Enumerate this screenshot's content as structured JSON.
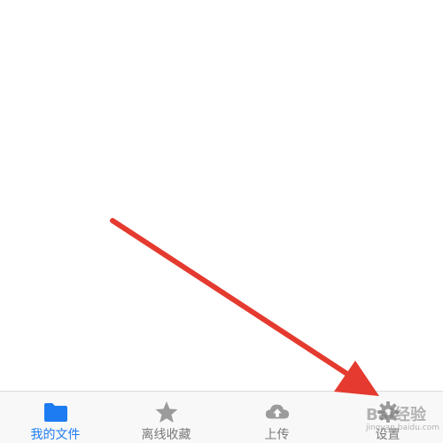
{
  "tabbar": {
    "tabs": [
      {
        "label": "我的文件",
        "icon": "folder-icon",
        "active": true
      },
      {
        "label": "离线收藏",
        "icon": "star-icon",
        "active": false
      },
      {
        "label": "上传",
        "icon": "cloud-upload-icon",
        "active": false
      },
      {
        "label": "设置",
        "icon": "gear-icon",
        "active": false
      }
    ]
  },
  "annotation": {
    "arrow_color": "#e53a2f"
  },
  "watermark": {
    "text": "Bai经验",
    "subtext": "jingyan.baidu.com"
  },
  "colors": {
    "active": "#1d7cf2",
    "inactive": "#7a7a7a",
    "icon_inactive": "#9b9b9b"
  }
}
